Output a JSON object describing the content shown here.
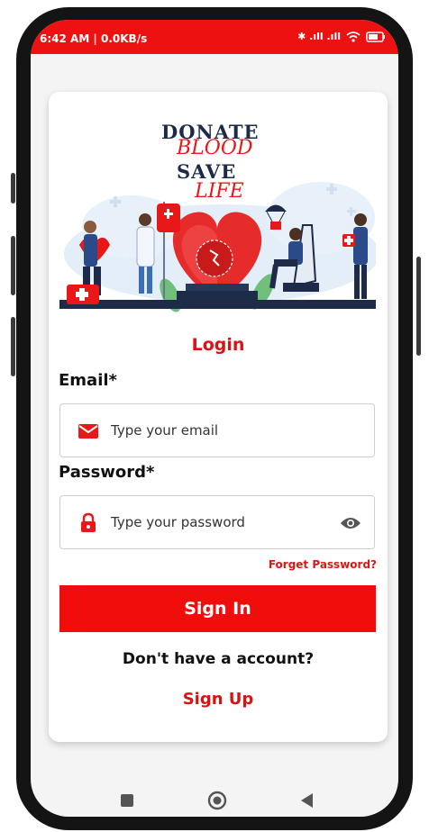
{
  "status_bar": {
    "time_info": "6:42 AM | 0.0KB/s",
    "right_indicators": "✱ .ıll .ıll"
  },
  "banner": {
    "line1": "DONATE",
    "line2": "BLOOD",
    "line3": "SAVE",
    "line4": "LIFE"
  },
  "form": {
    "title": "Login",
    "email_label": "Email*",
    "email_placeholder": "Type your email",
    "password_label": "Password*",
    "password_placeholder": "Type your password",
    "forget_password": "Forget Password?",
    "sign_in": "Sign In",
    "no_account": "Don't have a account?",
    "sign_up": "Sign Up"
  },
  "colors": {
    "accent": "#f20d0d",
    "status_bar": "#ee1111",
    "title_navy": "#1d2a48"
  },
  "icons": [
    "mail-icon",
    "lock-icon",
    "eye-icon",
    "square-nav-icon",
    "circle-nav-icon",
    "back-nav-icon"
  ]
}
